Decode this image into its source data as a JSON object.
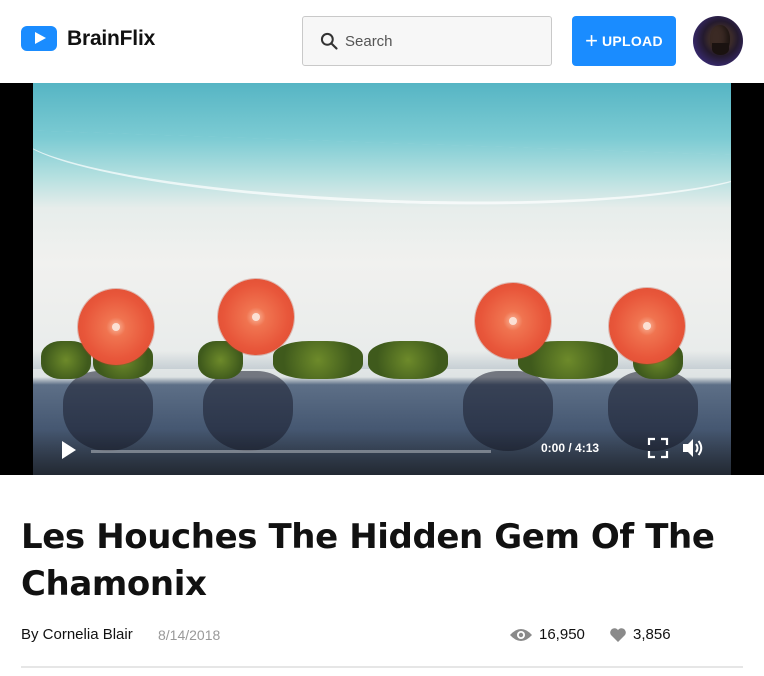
{
  "brand": {
    "name": "BrainFlix",
    "accent": "#1a8cff"
  },
  "search": {
    "placeholder": "Search"
  },
  "upload": {
    "label": "UPLOAD",
    "icon": "plus-icon"
  },
  "avatar": {
    "icon": "user-avatar"
  },
  "video": {
    "current_time": "0:00",
    "duration": "4:13",
    "time_display": "0:00 / 4:13",
    "progress": 0,
    "icons": [
      "play-icon",
      "fullscreen-icon",
      "volume-icon"
    ]
  },
  "article": {
    "title": "Les Houches The Hidden Gem Of The Chamonix",
    "author_line": "By Cornelia Blair",
    "date": "8/14/2018",
    "views": "16,950",
    "likes": "3,856",
    "icons": [
      "eye-icon",
      "heart-icon"
    ]
  }
}
